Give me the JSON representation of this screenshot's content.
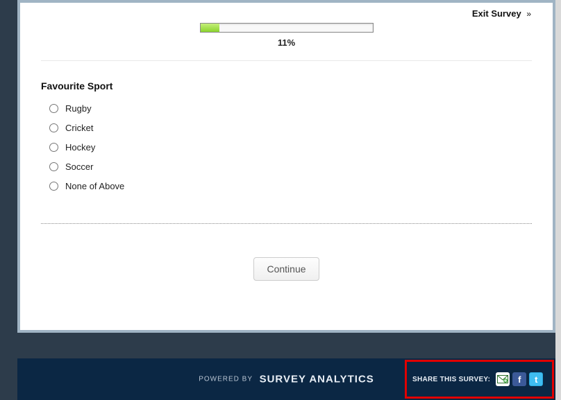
{
  "header": {
    "exit_label": "Exit Survey",
    "exit_glyph": "»"
  },
  "progress": {
    "percent_value": 11,
    "percent_label": "11%",
    "fill_width_pct": "11%"
  },
  "question": {
    "title": "Favourite Sport",
    "options": [
      {
        "label": "Rugby"
      },
      {
        "label": "Cricket"
      },
      {
        "label": "Hockey"
      },
      {
        "label": "Soccer"
      },
      {
        "label": "None of Above"
      }
    ]
  },
  "actions": {
    "continue_label": "Continue"
  },
  "footer": {
    "powered_prefix": "POWERED  BY",
    "brand": "SURVEY ANALYTICS",
    "share_label": "SHARE THIS SURVEY:",
    "share_icons": {
      "email": "email-icon",
      "facebook": "f",
      "twitter": "t"
    }
  },
  "colors": {
    "page_bg": "#2d3c4b",
    "footer_bg": "#0b2744",
    "highlight_border": "#e10000",
    "progress_fill": "#8bd42e"
  }
}
